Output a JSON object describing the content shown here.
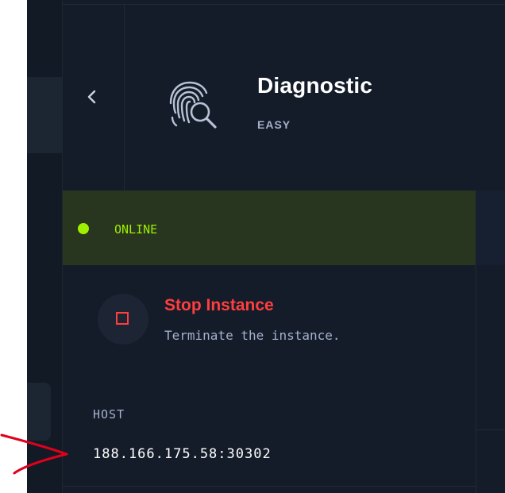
{
  "machine": {
    "name": "Diagnostic",
    "difficulty": "EASY",
    "icon": "fingerprint-search-icon"
  },
  "status": {
    "label": "ONLINE",
    "color": "#9fef00"
  },
  "actions": {
    "stop_title": "Stop Instance",
    "stop_description": "Terminate the instance.",
    "stop_color": "#ff3e3e"
  },
  "connection": {
    "host_label": "HOST",
    "host_value": "188.166.175.58:30302"
  },
  "theme": {
    "background": "#141c29",
    "accent": "#9fef00",
    "annotation_color": "#e0001b"
  }
}
